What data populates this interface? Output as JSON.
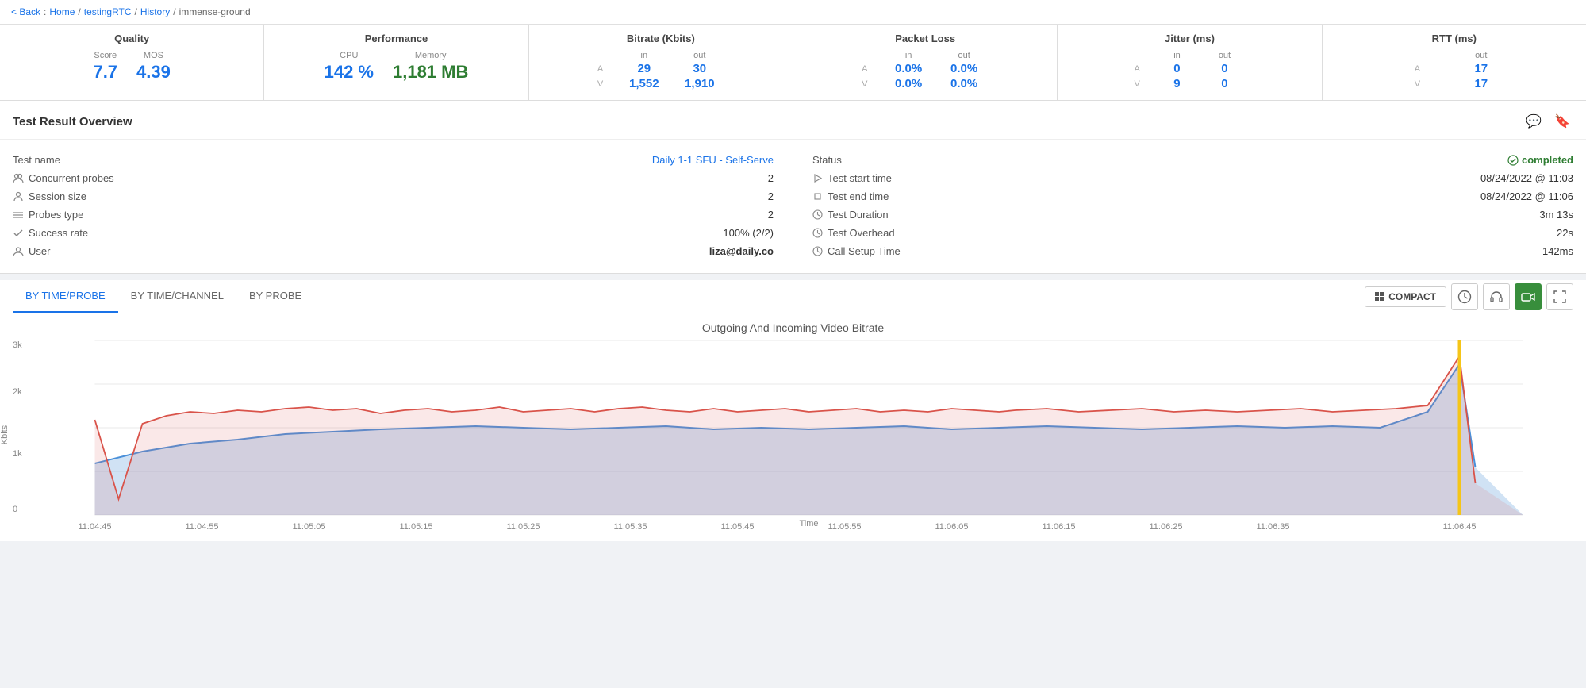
{
  "breadcrumb": {
    "back": "< Back",
    "home": "Home",
    "testing": "testingRTC",
    "history": "History",
    "current": "immense-ground"
  },
  "metrics": {
    "quality": {
      "title": "Quality",
      "score_label": "Score",
      "score_value": "7.7",
      "mos_label": "MOS",
      "mos_value": "4.39"
    },
    "performance": {
      "title": "Performance",
      "cpu_label": "CPU",
      "cpu_value": "142 %",
      "memory_label": "Memory",
      "memory_value": "1,181 MB"
    },
    "bitrate": {
      "title": "Bitrate (Kbits)",
      "in_label": "in",
      "out_label": "out",
      "a_in": "29",
      "a_out": "30",
      "v_in": "1,552",
      "v_out": "1,910"
    },
    "packet_loss": {
      "title": "Packet Loss",
      "in_label": "in",
      "out_label": "out",
      "a_in": "0.0%",
      "a_out": "0.0%",
      "v_in": "0.0%",
      "v_out": "0.0%"
    },
    "jitter": {
      "title": "Jitter (ms)",
      "in_label": "in",
      "out_label": "out",
      "a_in": "0",
      "a_out": "0",
      "v_in": "9",
      "v_out": "0"
    },
    "rtt": {
      "title": "RTT (ms)",
      "out_label": "out",
      "a_out": "17",
      "v_out": "17"
    }
  },
  "overview": {
    "title": "Test Result Overview",
    "test_name_label": "Test name",
    "test_name_value": "Daily 1-1 SFU - Self-Serve",
    "concurrent_probes_label": "Concurrent probes",
    "concurrent_probes_value": "2",
    "session_size_label": "Session size",
    "session_size_value": "2",
    "probes_type_label": "Probes type",
    "probes_type_value": "2",
    "success_rate_label": "Success rate",
    "success_rate_value": "100% (2/2)",
    "user_label": "User",
    "user_value": "liza@daily.co",
    "status_label": "Status",
    "status_value": "completed",
    "test_start_label": "Test start time",
    "test_start_value": "08/24/2022 @ 11:03",
    "test_end_label": "Test end time",
    "test_end_value": "08/24/2022 @ 11:06",
    "duration_label": "Test Duration",
    "duration_value": "3m 13s",
    "overhead_label": "Test Overhead",
    "overhead_value": "22s",
    "call_setup_label": "Call Setup Time",
    "call_setup_value": "142ms"
  },
  "tabs": {
    "items": [
      {
        "label": "BY TIME/PROBE",
        "active": true
      },
      {
        "label": "BY TIME/CHANNEL",
        "active": false
      },
      {
        "label": "BY PROBE",
        "active": false
      }
    ],
    "compact_label": "COMPACT"
  },
  "chart": {
    "title": "Outgoing And Incoming Video Bitrate",
    "y_label": "Kbits",
    "x_label": "Time",
    "y_max": "3k",
    "y_2k": "2k",
    "y_1k": "1k",
    "y_0": "0",
    "times": [
      "11:04:45",
      "11:04:55",
      "11:05:05",
      "11:05:15",
      "11:05:25",
      "11:05:35",
      "11:05:45",
      "11:05:55",
      "11:06:05",
      "11:06:15",
      "11:06:25",
      "11:06:35",
      "11:06:45"
    ]
  }
}
